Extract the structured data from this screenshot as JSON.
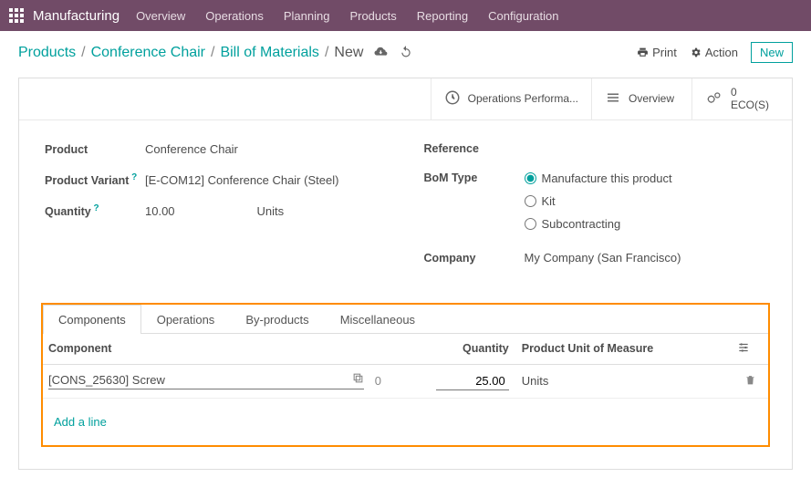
{
  "navbar": {
    "brand": "Manufacturing",
    "items": [
      "Overview",
      "Operations",
      "Planning",
      "Products",
      "Reporting",
      "Configuration"
    ]
  },
  "breadcrumb": {
    "parts": [
      "Products",
      "Conference Chair",
      "Bill of Materials"
    ],
    "current": "New"
  },
  "controls": {
    "print": "Print",
    "action": "Action",
    "new": "New"
  },
  "statbuttons": {
    "opsperf": {
      "label": "Operations Performa..."
    },
    "overview": {
      "label": "Overview"
    },
    "ecos": {
      "num": "0",
      "label": "ECO(S)"
    }
  },
  "form": {
    "left": {
      "product": {
        "label": "Product",
        "value": "Conference Chair"
      },
      "variant": {
        "label": "Product Variant",
        "value": "[E-COM12] Conference Chair (Steel)"
      },
      "quantity": {
        "label": "Quantity",
        "value": "10.00",
        "unit": "Units"
      }
    },
    "right": {
      "reference": {
        "label": "Reference",
        "value": ""
      },
      "bomtype": {
        "label": "BoM Type",
        "options": [
          "Manufacture this product",
          "Kit",
          "Subcontracting"
        ],
        "selected": 0
      },
      "company": {
        "label": "Company",
        "value": "My Company (San Francisco)"
      }
    }
  },
  "tabs": [
    "Components",
    "Operations",
    "By-products",
    "Miscellaneous"
  ],
  "table": {
    "headers": {
      "component": "Component",
      "qty": "Quantity",
      "uom": "Product Unit of Measure"
    },
    "rows": [
      {
        "component": "[CONS_25630] Screw",
        "seq": "0",
        "qty": "25.00",
        "uom": "Units"
      }
    ],
    "add_line": "Add a line"
  }
}
